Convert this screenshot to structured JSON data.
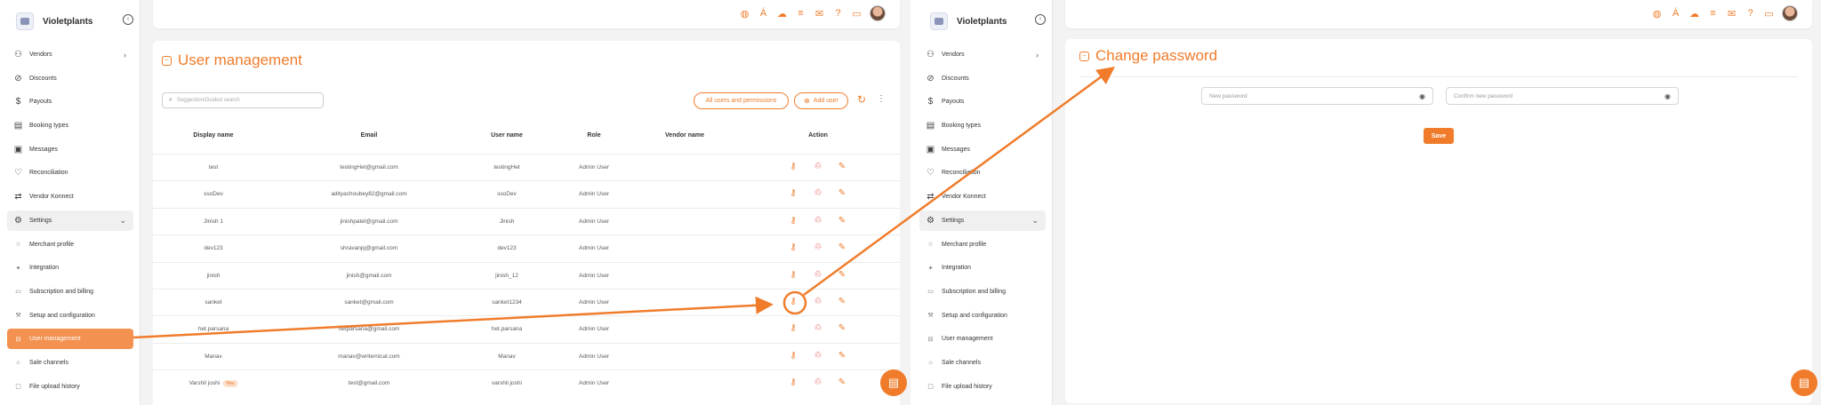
{
  "brand": {
    "name": "Violetplants"
  },
  "nav": [
    {
      "label": "Vendors",
      "icon": "users-icon",
      "glyph": "⚇",
      "type": "main",
      "chevron": "›"
    },
    {
      "label": "Discounts",
      "icon": "discount-icon",
      "glyph": "⊘",
      "type": "main"
    },
    {
      "label": "Payouts",
      "icon": "dollar-icon",
      "glyph": "$",
      "type": "main"
    },
    {
      "label": "Booking types",
      "icon": "folder-icon",
      "glyph": "▤",
      "type": "main"
    },
    {
      "label": "Messages",
      "icon": "messages-icon",
      "glyph": "▣",
      "type": "main"
    },
    {
      "label": "Reconciliation",
      "icon": "handshake-icon",
      "glyph": "♡",
      "type": "main"
    },
    {
      "label": "Vendor Konnect",
      "icon": "swap-icon",
      "glyph": "⇄",
      "type": "main"
    },
    {
      "label": "Settings",
      "icon": "gear-icon",
      "glyph": "⚙",
      "type": "open",
      "chevron": "⌄"
    },
    {
      "label": "Merchant profile",
      "icon": "profile-icon",
      "glyph": "☆",
      "type": "sub"
    },
    {
      "label": "Integration",
      "icon": "integration-icon",
      "glyph": "✦",
      "type": "sub"
    },
    {
      "label": "Subscription and billing",
      "icon": "billing-icon",
      "glyph": "▭",
      "type": "sub"
    },
    {
      "label": "Setup and configuration",
      "icon": "setup-icon",
      "glyph": "⚒",
      "type": "sub"
    },
    {
      "label": "User management",
      "icon": "user-management-icon",
      "glyph": "⊟",
      "type": "sub"
    },
    {
      "label": "Sale channels",
      "icon": "sale-channels-icon",
      "glyph": "⌂",
      "type": "sub"
    },
    {
      "label": "File upload history",
      "icon": "file-history-icon",
      "glyph": "▢",
      "type": "sub"
    }
  ],
  "topbar_icons": [
    {
      "name": "globe-icon",
      "glyph": "◍"
    },
    {
      "name": "translate-icon",
      "glyph": "Ȧ"
    },
    {
      "name": "cloud-icon",
      "glyph": "☁"
    },
    {
      "name": "list-icon",
      "glyph": "≡"
    },
    {
      "name": "megaphone-icon",
      "glyph": "✉"
    },
    {
      "name": "help-icon",
      "glyph": "?"
    },
    {
      "name": "wallet-icon",
      "glyph": "▭"
    }
  ],
  "user_management": {
    "title": "User management",
    "search_placeholder": "Suggestion/Guided search",
    "all_users_button": "All users and permissions",
    "add_user_button": "Add user",
    "columns": [
      "Display name",
      "Email",
      "User name",
      "Role",
      "Vendor name",
      "Action"
    ],
    "rows": [
      {
        "display": "test",
        "email": "testingHet@gmail.com",
        "username": "testingHet",
        "role": "Admin User",
        "vendor": ""
      },
      {
        "display": "ssoDev",
        "email": "adityachoubey82@gmail.com",
        "username": "ssoDev",
        "role": "Admin User",
        "vendor": ""
      },
      {
        "display": "Jinish 1",
        "email": "jinishpatel@gmail.com",
        "username": "Jinish",
        "role": "Admin User",
        "vendor": ""
      },
      {
        "display": "dev123",
        "email": "shravanpj@gmail.com",
        "username": "dev123",
        "role": "Admin User",
        "vendor": ""
      },
      {
        "display": "jinish",
        "email": "jinish@gmail.com",
        "username": "jinish_12",
        "role": "Admin User",
        "vendor": ""
      },
      {
        "display": "sanket",
        "email": "sanket@gmail.com",
        "username": "sanket1234",
        "role": "Admin User",
        "vendor": ""
      },
      {
        "display": "het.parsana",
        "email": "hetparsana@gmail.com",
        "username": "het.parsana",
        "role": "Admin User",
        "vendor": ""
      },
      {
        "display": "Manav",
        "email": "manav@writernical.com",
        "username": "Manav",
        "role": "Admin User",
        "vendor": ""
      },
      {
        "display": "Varshil joshi",
        "email": "test@gmail.com",
        "username": "varshil.joshi",
        "role": "Admin User",
        "vendor": "",
        "badge": "You"
      }
    ]
  },
  "change_password": {
    "title": "Change password",
    "new_password_placeholder": "New password",
    "confirm_password_placeholder": "Confirm new password",
    "save_button": "Save"
  },
  "colors": {
    "accent": "#f07c2b",
    "delete": "#e24a4a",
    "active_nav": "#f39150"
  },
  "icons": {
    "key": "⚷",
    "delete": "♲",
    "edit": "✎",
    "chat": "▤",
    "search": "⌕",
    "refresh": "↻",
    "more": "⋮",
    "add": "⊕",
    "eye": "◉",
    "title": "□"
  }
}
